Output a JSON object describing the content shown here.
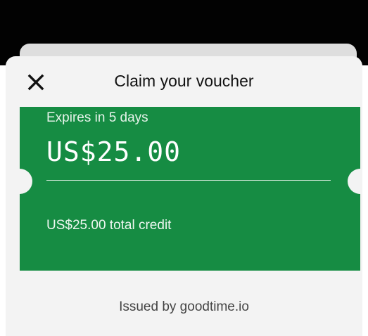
{
  "header": {
    "title": "Claim your voucher",
    "close_icon": "close-icon"
  },
  "voucher": {
    "expires": "Expires in 5 days",
    "amount": "US$25.00",
    "total_credit": "US$25.00 total credit",
    "accent_color": "#168c43"
  },
  "footer": {
    "issued_by": "Issued by goodtime.io"
  }
}
